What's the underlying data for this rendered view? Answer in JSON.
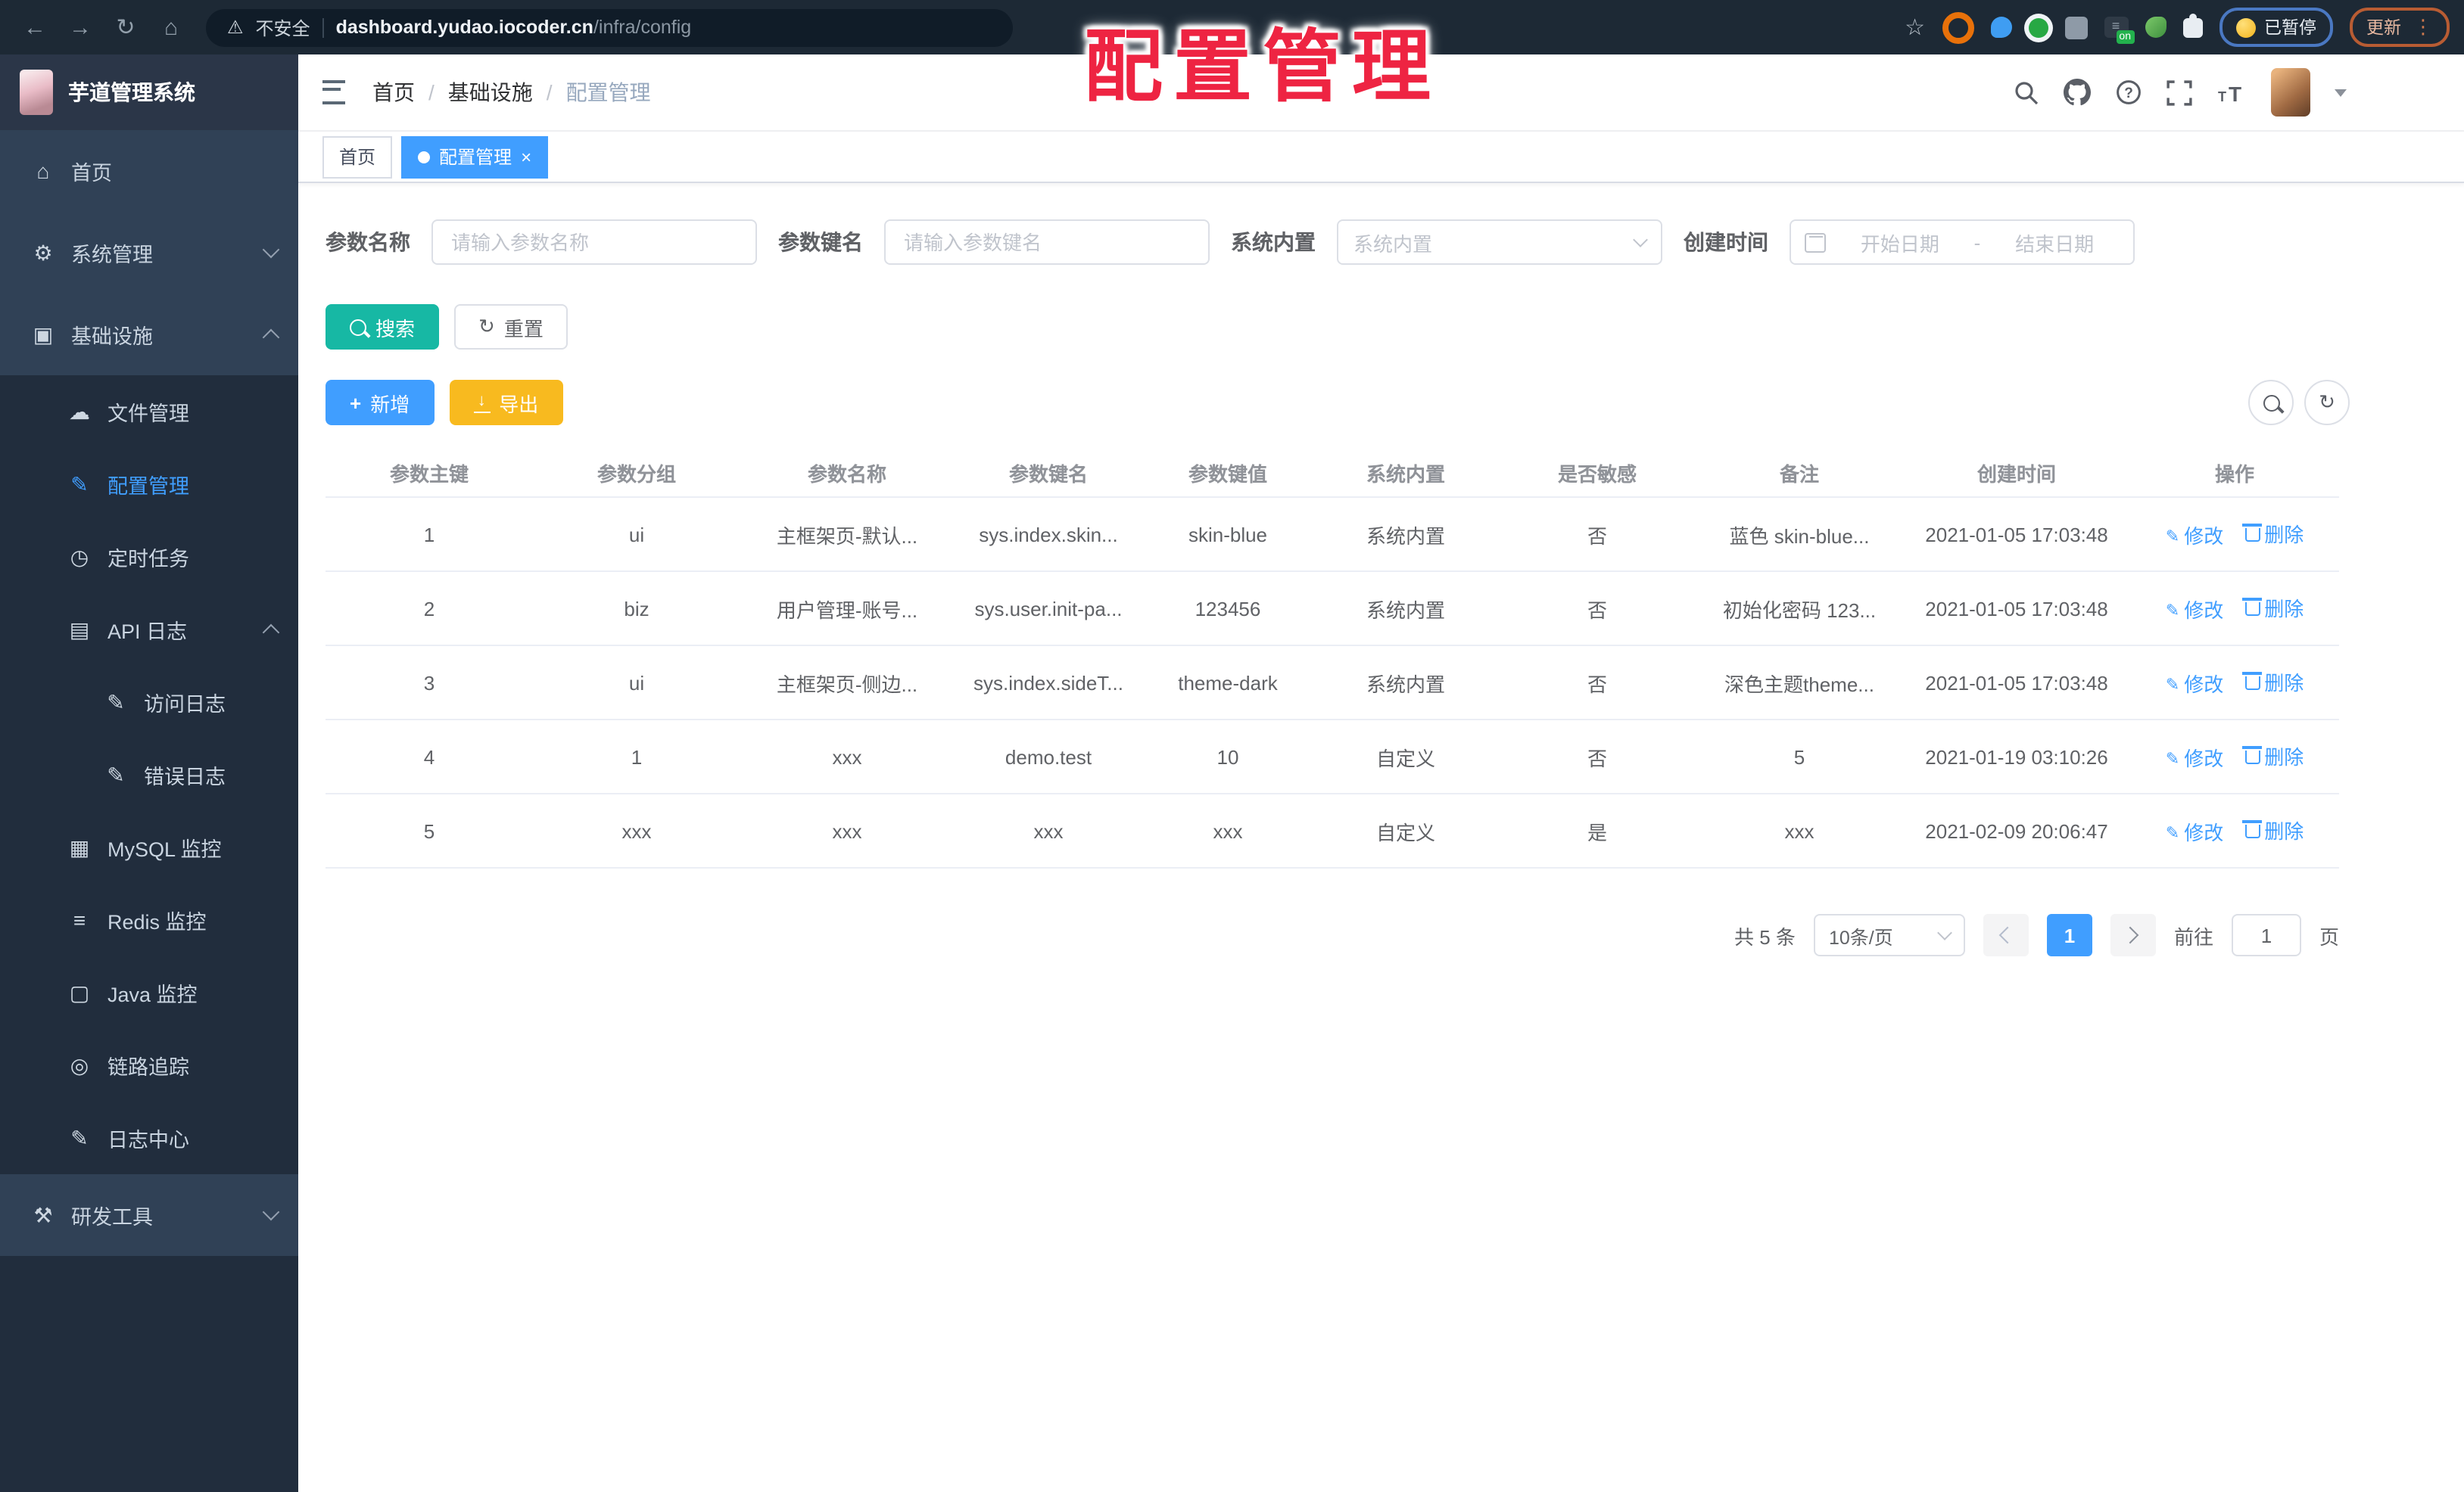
{
  "watermark": "配置管理",
  "browser": {
    "security": "不安全",
    "host": "dashboard.yudao.iocoder.cn",
    "path": "/infra/config",
    "on_badge": "on",
    "paused": "已暂停",
    "update": "更新"
  },
  "sidebar": {
    "app_title": "芋道管理系统",
    "items": [
      {
        "label": "首页"
      },
      {
        "label": "系统管理"
      },
      {
        "label": "基础设施"
      },
      {
        "label": "文件管理"
      },
      {
        "label": "配置管理"
      },
      {
        "label": "定时任务"
      },
      {
        "label": "API 日志"
      },
      {
        "label": "访问日志"
      },
      {
        "label": "错误日志"
      },
      {
        "label": "MySQL 监控"
      },
      {
        "label": "Redis 监控"
      },
      {
        "label": "Java 监控"
      },
      {
        "label": "链路追踪"
      },
      {
        "label": "日志中心"
      },
      {
        "label": "研发工具"
      }
    ]
  },
  "breadcrumb": {
    "sep": "/",
    "items": [
      {
        "label": "首页"
      },
      {
        "label": "基础设施"
      },
      {
        "label": "配置管理"
      }
    ]
  },
  "tabs": [
    {
      "label": "首页"
    },
    {
      "label": "配置管理"
    }
  ],
  "form": {
    "name_label": "参数名称",
    "name_placeholder": "请输入参数名称",
    "key_label": "参数键名",
    "key_placeholder": "请输入参数键名",
    "builtin_label": "系统内置",
    "builtin_placeholder": "系统内置",
    "date_label": "创建时间",
    "date_start": "开始日期",
    "date_sep": "-",
    "date_end": "结束日期",
    "search": "搜索",
    "reset": "重置"
  },
  "toolbar": {
    "add": "新增",
    "export": "导出"
  },
  "table": {
    "columns": [
      "参数主键",
      "参数分组",
      "参数名称",
      "参数键名",
      "参数键值",
      "系统内置",
      "是否敏感",
      "备注",
      "创建时间",
      "操作"
    ],
    "rows": [
      [
        "1",
        "ui",
        "主框架页-默认...",
        "sys.index.skin...",
        "skin-blue",
        "系统内置",
        "否",
        "蓝色 skin-blue...",
        "2021-01-05 17:03:48"
      ],
      [
        "2",
        "biz",
        "用户管理-账号...",
        "sys.user.init-pa...",
        "123456",
        "系统内置",
        "否",
        "初始化密码 123...",
        "2021-01-05 17:03:48"
      ],
      [
        "3",
        "ui",
        "主框架页-侧边...",
        "sys.index.sideT...",
        "theme-dark",
        "系统内置",
        "否",
        "深色主题theme...",
        "2021-01-05 17:03:48"
      ],
      [
        "4",
        "1",
        "xxx",
        "demo.test",
        "10",
        "自定义",
        "否",
        "5",
        "2021-01-19 03:10:26"
      ],
      [
        "5",
        "xxx",
        "xxx",
        "xxx",
        "xxx",
        "自定义",
        "是",
        "xxx",
        "2021-02-09 20:06:47"
      ]
    ],
    "edit": "修改",
    "delete": "删除"
  },
  "pagination": {
    "total": "共 5 条",
    "size": "10条/页",
    "page": "1",
    "goto": "前往",
    "goto_value": "1",
    "unit": "页"
  },
  "colors": {
    "accent": "#409eff",
    "search_button": "#17b8a4",
    "export_button": "#f8ba1f",
    "sidebar_bg": "#212d3d",
    "sidebar_item_bg": "#304156",
    "watermark_red": "#ee2442"
  }
}
